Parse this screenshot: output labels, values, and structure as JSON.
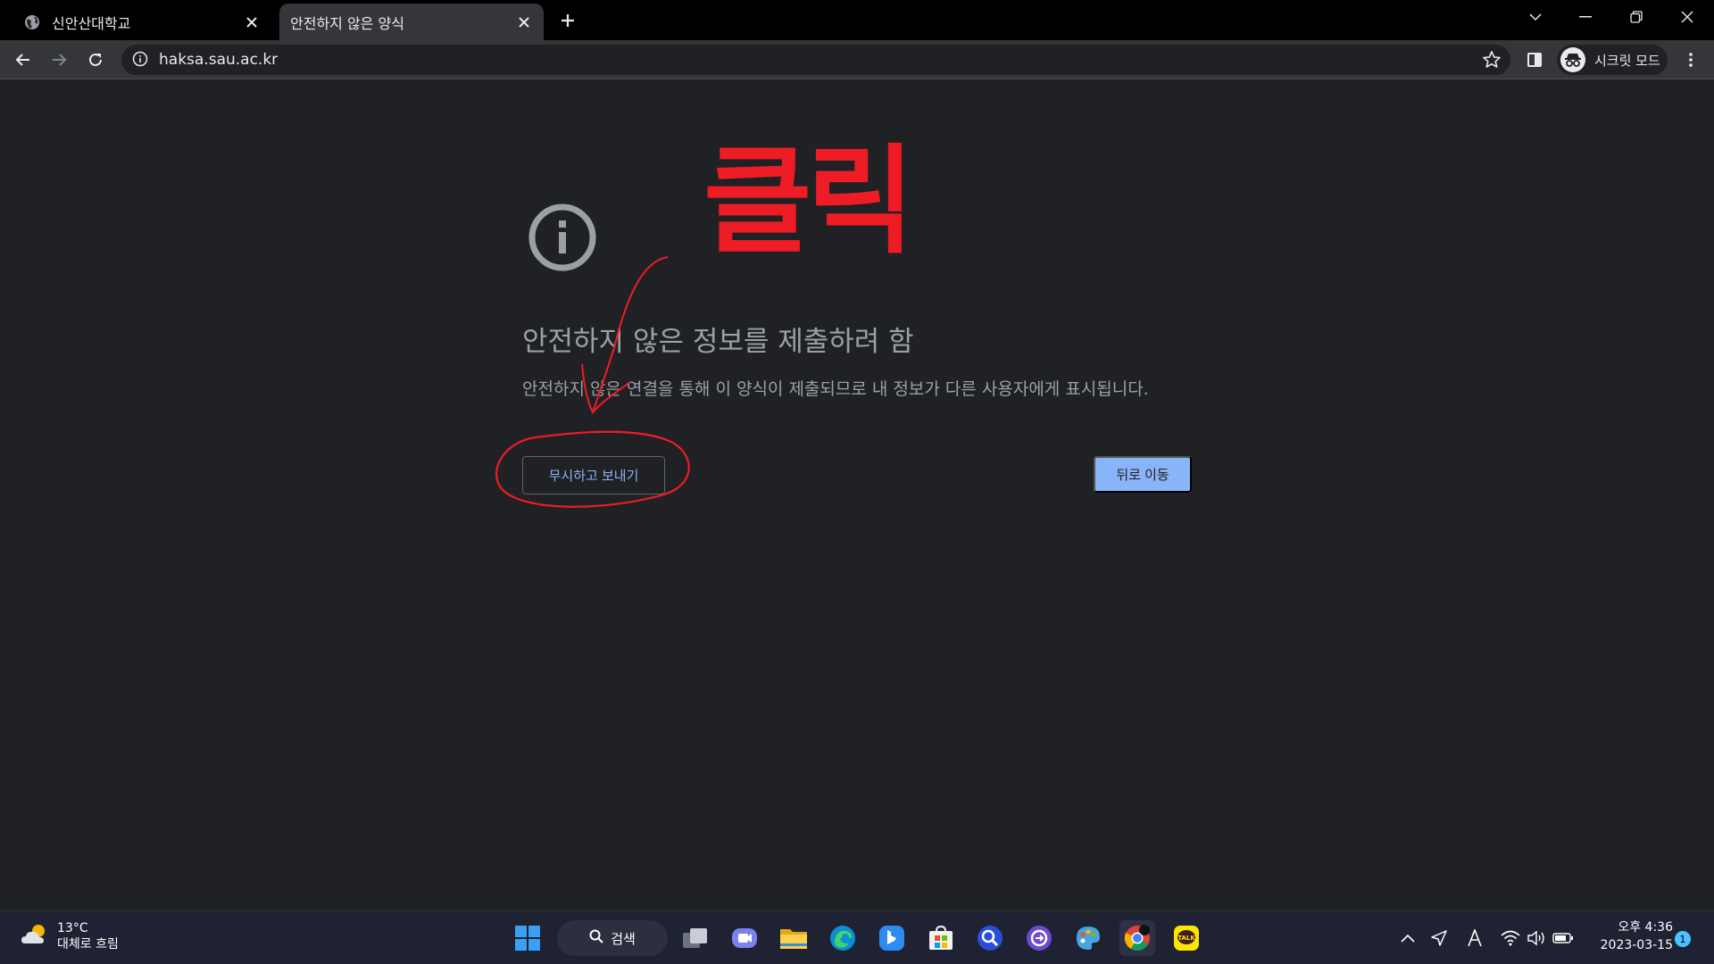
{
  "browser": {
    "tabs": [
      {
        "title": "신안산대학교",
        "active": false,
        "favicon": "globe-icon"
      },
      {
        "title": "안전하지 않은 양식",
        "active": true,
        "favicon": "none"
      }
    ],
    "address": {
      "url": "haksa.sau.ac.kr"
    },
    "incognito_label": "시크릿 모드"
  },
  "page": {
    "heading": "안전하지 않은 정보를 제출하려 함",
    "description": "안전하지 않은 연결을 통해 이 양식이 제출되므로 내 정보가 다른 사용자에게 표시됩니다.",
    "proceed_button": "무시하고 보내기",
    "back_button": "뒤로 이동"
  },
  "annotation": {
    "text": "클릭",
    "color": "#ee1c25"
  },
  "taskbar": {
    "weather": {
      "temp": "13°C",
      "condition": "대체로 흐림"
    },
    "search_label": "검색",
    "apps": [
      "start-icon",
      "task-view-icon",
      "chat-icon",
      "file-explorer-icon",
      "edge-icon",
      "bing-icon",
      "store-icon",
      "search-app-icon",
      "copilot-icon",
      "paint-icon",
      "chrome-icon",
      "kakaotalk-icon"
    ],
    "clock": {
      "time": "오후 4:36",
      "date": "2023-03-15"
    },
    "notification_count": "1"
  },
  "colors": {
    "page_bg": "#202124",
    "accent_blue": "#8ab4f8",
    "text_gray": "#9aa0a6"
  }
}
